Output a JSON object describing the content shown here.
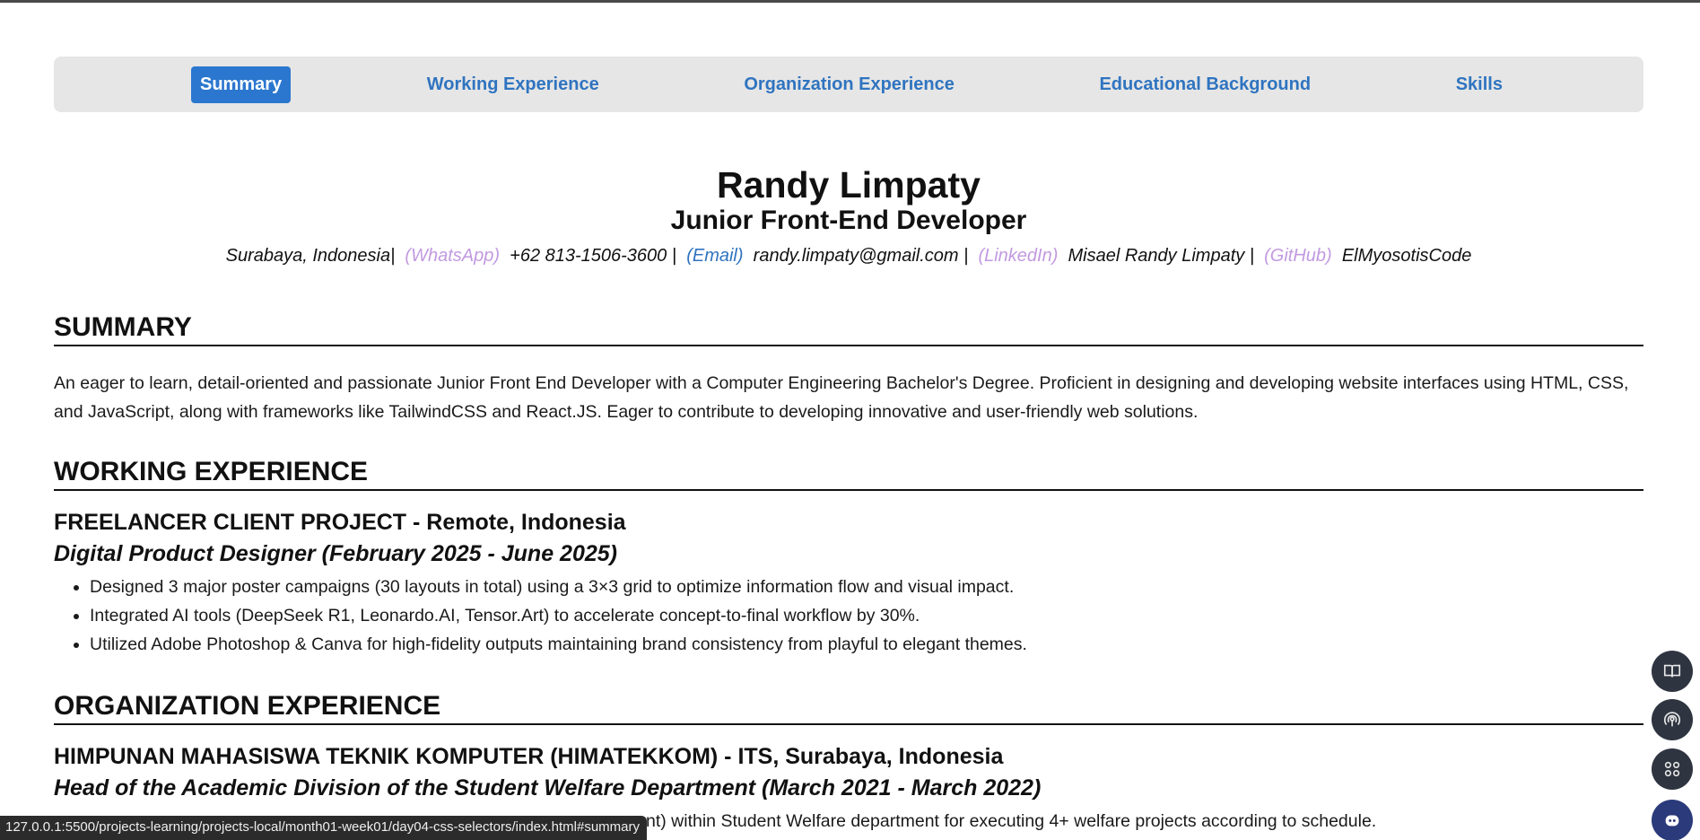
{
  "nav": {
    "items": [
      {
        "label": "Summary",
        "active": true
      },
      {
        "label": "Working Experience",
        "active": false
      },
      {
        "label": "Organization Experience",
        "active": false
      },
      {
        "label": "Educational Background",
        "active": false
      },
      {
        "label": "Skills",
        "active": false
      }
    ]
  },
  "header": {
    "name": "Randy Limpaty",
    "role": "Junior Front-End Developer",
    "location": "Surabaya, Indonesia",
    "whatsapp_tag": "(WhatsApp)",
    "whatsapp": "+62 813-1506-3600",
    "email_tag": "(Email)",
    "email": "randy.limpaty@gmail.com",
    "linkedin_tag": "(LinkedIn)",
    "linkedin": "Misael Randy Limpaty",
    "github_tag": "(GitHub)",
    "github": "ElMyosotisCode",
    "separator": "|"
  },
  "summary": {
    "title": "SUMMARY",
    "text": "An eager to learn, detail-oriented and passionate Junior Front End Developer with a Computer Engineering Bachelor's Degree. Proficient in designing and developing website interfaces using HTML, CSS, and JavaScript, along with frameworks like TailwindCSS and React.JS. Eager to contribute to developing innovative and user-friendly web solutions."
  },
  "work": {
    "title": "WORKING EXPERIENCE",
    "org": "FREELANCER CLIENT PROJECT - Remote, Indonesia",
    "position": "Digital Product Designer (February 2025 - June 2025)",
    "bullets": [
      "Designed 3 major poster campaigns (30 layouts in total) using a 3×3 grid to optimize information flow and visual impact.",
      "Integrated AI tools (DeepSeek R1, Leonardo.AI, Tensor.Art) to accelerate concept-to-final workflow by 30%.",
      "Utilized Adobe Photoshop & Canva for high-fidelity outputs maintaining brand consistency from playful to elegant themes."
    ]
  },
  "organization": {
    "title": "ORGANIZATION EXPERIENCE",
    "org": "HIMPUNAN MAHASISWA TEKNIK KOMPUTER (HIMATEKKOM) - ITS, Surabaya, Indonesia",
    "position": "Head of the Academic Division of the Student Welfare Department (March 2021 - March 2022)",
    "bullet_visible": "nt) within Student Welfare department for executing 4+ welfare projects according to schedule."
  },
  "statusbar": {
    "url": "127.0.0.1:5500/projects-learning/projects-local/month01-week01/day04-css-selectors/index.html#summary"
  },
  "side_buttons": [
    "book-icon",
    "broadcast-icon",
    "apps-grid-icon",
    "assistant-bot-icon"
  ]
}
